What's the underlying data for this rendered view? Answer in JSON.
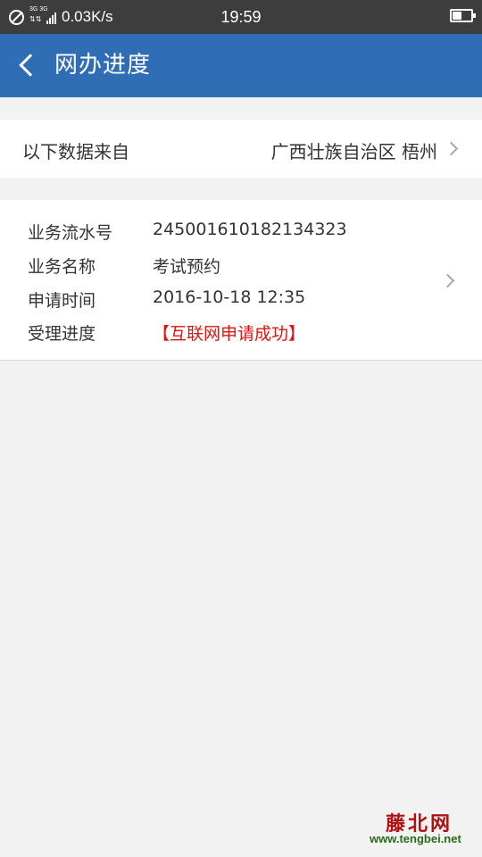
{
  "status_bar": {
    "net_label": "3G 3G",
    "speed": "0.03K/s",
    "time": "19:59"
  },
  "navbar": {
    "title": "网办进度"
  },
  "source": {
    "label": "以下数据来自",
    "value": "广西壮族自治区 梧州"
  },
  "record": {
    "fields": [
      {
        "label": "业务流水号",
        "value": "245001610182134323"
      },
      {
        "label": "业务名称",
        "value": "考试预约"
      },
      {
        "label": "申请时间",
        "value": "2016-10-18 12:35"
      },
      {
        "label": "受理进度",
        "value": "【互联网申请成功】"
      }
    ],
    "status_color": "#e01414"
  },
  "watermark": {
    "logo": "藤北网",
    "url": "www.tengbei.net"
  },
  "colors": {
    "nav_bg": "#2f6db5",
    "status_bar_bg": "#3d3d3d",
    "page_bg": "#f2f2f2"
  }
}
